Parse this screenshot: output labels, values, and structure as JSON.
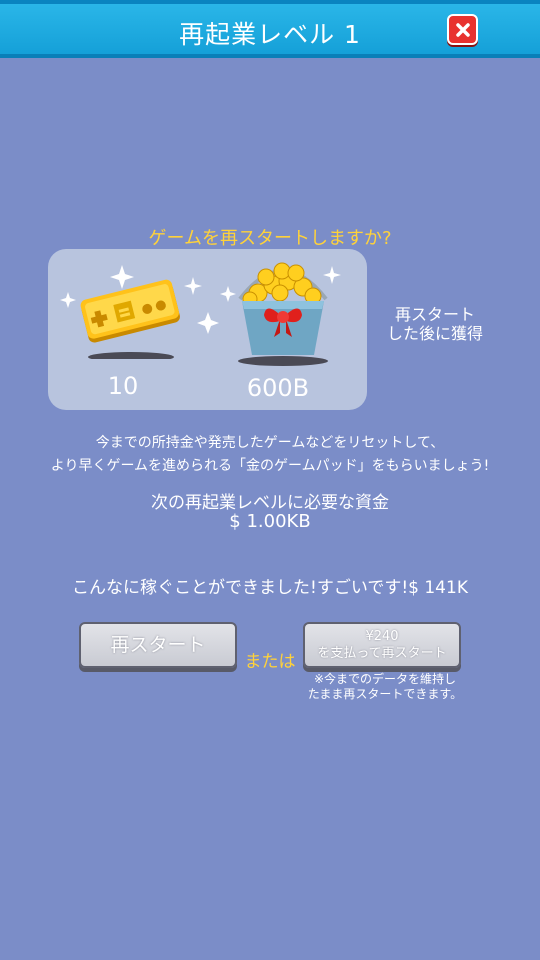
{
  "header": {
    "title": "再起業レベル 1"
  },
  "dialog": {
    "question": "ゲームを再スタートしますか?",
    "rewards": [
      {
        "icon": "gold-gamepad-icon",
        "value": "10"
      },
      {
        "icon": "gold-coin-bucket-icon",
        "value": "600B"
      }
    ],
    "after_label_line1": "再スタート",
    "after_label_line2": "した後に獲得",
    "description_line1": "今までの所持金や発売したゲームなどをリセットして、",
    "description_line2": "より早くゲームを進められる「金のゲームパッド」をもらいましょう!",
    "required_label": "次の再起業レベルに必要な資金",
    "required_value": "$ 1.00KB",
    "earned_text": "こんなに稼ぐことができました!すごいです!$ 141K",
    "restart_button": "再スタート",
    "or_text": "または",
    "pay_price": "¥240",
    "pay_label": "を支払って再スタート",
    "note_line1": "※今までのデータを維持し",
    "note_line2": "たまま再スタートできます。"
  },
  "colors": {
    "background": "#7b8dc8",
    "titlebar": "#1fa9e0",
    "accent_yellow": "#ffd23a",
    "close_red": "#e8322f"
  }
}
